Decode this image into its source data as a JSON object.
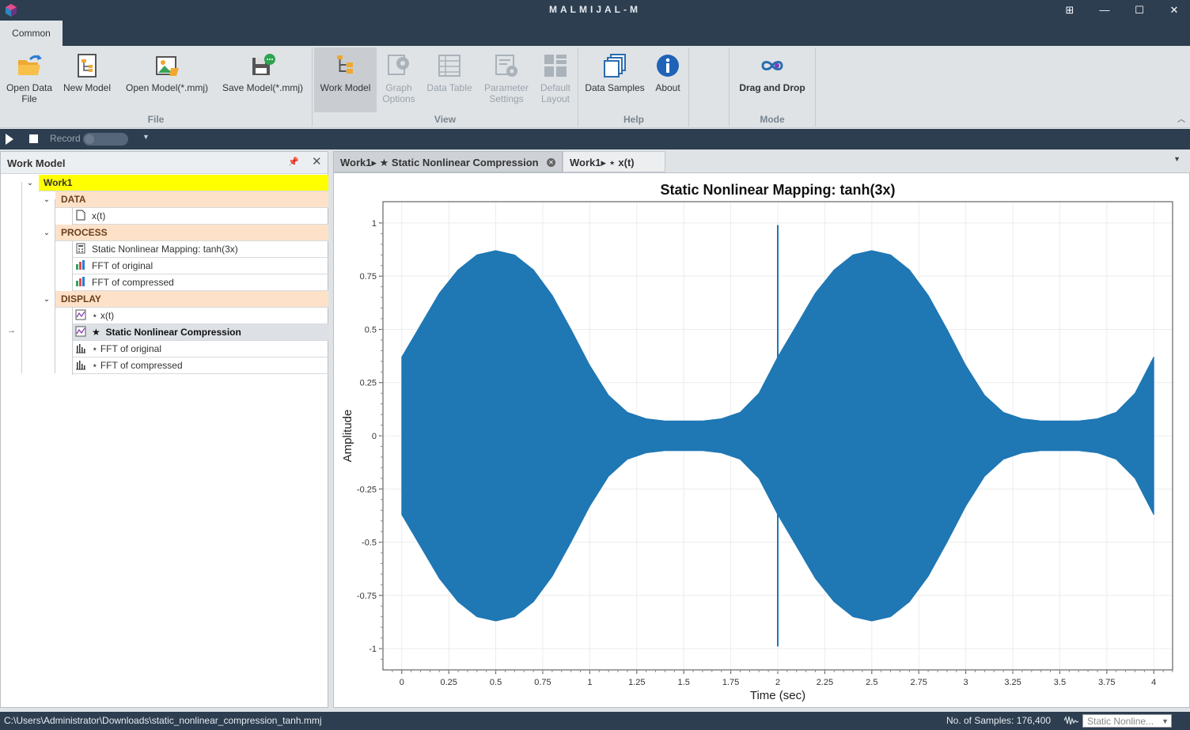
{
  "app": {
    "title": "MALMIJAL-M",
    "window_buttons": [
      "⊞",
      "—",
      "☐",
      "✕"
    ]
  },
  "ribbon": {
    "tab": "Common",
    "groups": {
      "file": "File",
      "view": "View",
      "help": "Help",
      "mode": "Mode"
    },
    "buttons": {
      "open_data_file_1": "Open Data",
      "open_data_file_2": "File",
      "new_model": "New Model",
      "open_model": "Open Model(*.mmj)",
      "save_model": "Save Model(*.mmj)",
      "work_model": "Work Model",
      "graph_options_1": "Graph",
      "graph_options_2": "Options",
      "data_table": "Data Table",
      "parameter_settings_1": "Parameter",
      "parameter_settings_2": "Settings",
      "default_layout_1": "Default",
      "default_layout_2": "Layout",
      "data_samples": "Data Samples",
      "about": "About",
      "drag_and_drop": "Drag and Drop"
    }
  },
  "toolbar": {
    "record_label": "Record"
  },
  "work_model": {
    "title": "Work Model",
    "root": "Work1",
    "categories": {
      "data": "DATA",
      "process": "PROCESS",
      "display": "DISPLAY"
    },
    "data_items": [
      "x(t)"
    ],
    "process_items": [
      "Static Nonlinear Mapping: tanh(3x)",
      "FFT of original",
      "FFT of compressed"
    ],
    "display_items": [
      "⋆ x(t)",
      "Static Nonlinear Compression",
      "⋆ FFT of original",
      "⋆ FFT of compressed"
    ],
    "selected_star": "★",
    "arrow": "→"
  },
  "doc_tabs": {
    "tab1_prefix": "Work1▸ ★",
    "tab1_title": "Static Nonlinear Compression",
    "tab2_prefix": "Work1▸ ⋆",
    "tab2_title": "x(t)"
  },
  "chart_data": {
    "type": "line",
    "title": "Static Nonlinear Mapping: tanh(3x)",
    "xlabel": "Time (sec)",
    "ylabel": "Amplitude",
    "xlim": [
      -0.1,
      4.1
    ],
    "ylim": [
      -1.1,
      1.1
    ],
    "x_ticks": [
      0,
      0.25,
      0.5,
      0.75,
      1,
      1.25,
      1.5,
      1.75,
      2,
      2.25,
      2.5,
      2.75,
      3,
      3.25,
      3.5,
      3.75,
      4
    ],
    "x_tick_labels": [
      "0",
      "0.25",
      "0.5",
      "0.75",
      "1",
      "1.25",
      "1.5",
      "1.75",
      "2",
      "2.25",
      "2.5",
      "2.75",
      "3",
      "3.25",
      "3.5",
      "3.75",
      "4"
    ],
    "y_ticks": [
      1,
      0.75,
      0.5,
      0.25,
      0,
      -0.25,
      -0.5,
      -0.75,
      -1
    ],
    "y_tick_labels": [
      "1",
      "0.75",
      "0.5",
      "0.25",
      "0",
      "-0.25",
      "-0.5",
      "-0.75",
      "-1"
    ],
    "color": "#1f77b4",
    "envelope": {
      "x": [
        0,
        0.1,
        0.2,
        0.3,
        0.4,
        0.5,
        0.6,
        0.7,
        0.8,
        0.9,
        1.0,
        1.1,
        1.2,
        1.3,
        1.4,
        1.5,
        1.6,
        1.7,
        1.8,
        1.9,
        2.0,
        2.1,
        2.2,
        2.3,
        2.4,
        2.5,
        2.6,
        2.7,
        2.8,
        2.9,
        3.0,
        3.1,
        3.2,
        3.3,
        3.4,
        3.5,
        3.6,
        3.7,
        3.8,
        3.9,
        4.0
      ],
      "upper": [
        0.37,
        0.52,
        0.67,
        0.78,
        0.85,
        0.87,
        0.85,
        0.78,
        0.66,
        0.5,
        0.33,
        0.19,
        0.11,
        0.08,
        0.07,
        0.07,
        0.07,
        0.08,
        0.11,
        0.2,
        0.37,
        0.52,
        0.67,
        0.78,
        0.85,
        0.87,
        0.85,
        0.78,
        0.66,
        0.5,
        0.33,
        0.19,
        0.11,
        0.08,
        0.07,
        0.07,
        0.07,
        0.08,
        0.11,
        0.2,
        0.37
      ]
    },
    "spike": {
      "x": 2.0,
      "ymin": -0.99,
      "ymax": 0.99
    }
  },
  "status": {
    "path": "C:\\Users\\Administrator\\Downloads\\static_nonlinear_compression_tanh.mmj",
    "samples": "No. of Samples: 176,400",
    "combo": "Static Nonline..."
  }
}
